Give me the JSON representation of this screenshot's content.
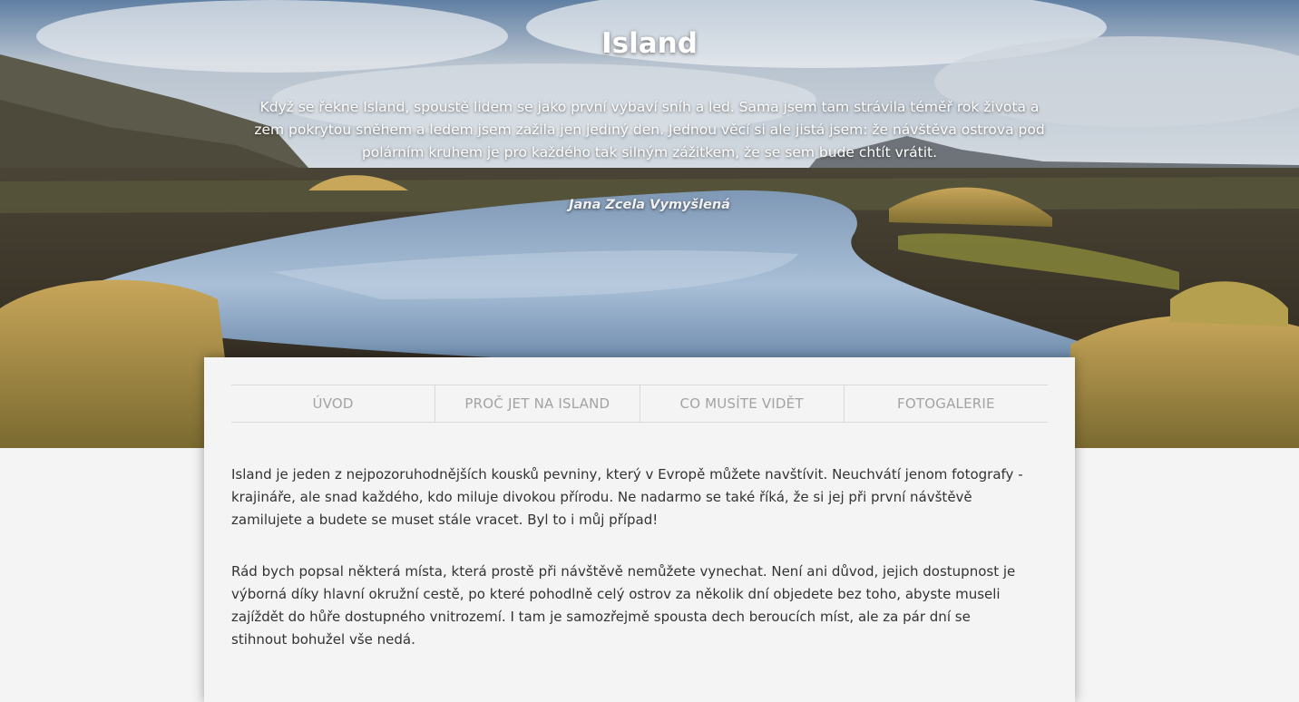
{
  "hero": {
    "title": "Island",
    "quote": "Když se řekne Island, spoustě lidem se jako první vybaví sníh a led. Sama jsem tam strávila téměř rok života a zem pokrytou sněhem a ledem jsem zažila jen jediný den. Jednou věcí si ale jistá jsem: že návštěva ostrova pod polárním kruhem je pro každého tak silným zážitkem, že se sem bude chtít vrátit.",
    "author": "Jana Zcela Vymyšlená"
  },
  "nav": {
    "items": [
      {
        "label": "ÚVOD"
      },
      {
        "label": "PROČ JET NA ISLAND"
      },
      {
        "label": "CO MUSÍTE VIDĚT"
      },
      {
        "label": "FOTOGALERIE"
      }
    ]
  },
  "main": {
    "paragraphs": [
      "Island je jeden z nejpozoruhodnějších kousků pevniny, který v Evropě můžete navštívit. Neuchvátí jenom fotografy - krajináře, ale snad každého, kdo miluje divokou přírodu. Ne nadarmo se také říká, že si jej při první návštěvě zamilujete a budete se muset stále vracet. Byl to i můj případ!",
      "Rád bych popsal některá místa, která prostě při návštěvě nemůžete vynechat. Není ani důvod, jejich dostupnost je výborná díky hlavní okružní cestě, po které pohodlně celý ostrov za několik dní objedete bez toho, abyste museli zajíždět do hůře dostupného vnitrozemí. I tam je samozřejmě spousta dech beroucích míst, ale za pár dní se stihnout bohužel vše nedá."
    ]
  },
  "colors": {
    "page_background": "#f4f4f4",
    "nav_text": "#a3a3a3",
    "body_text": "#333333",
    "divider": "#d9d9d9"
  }
}
